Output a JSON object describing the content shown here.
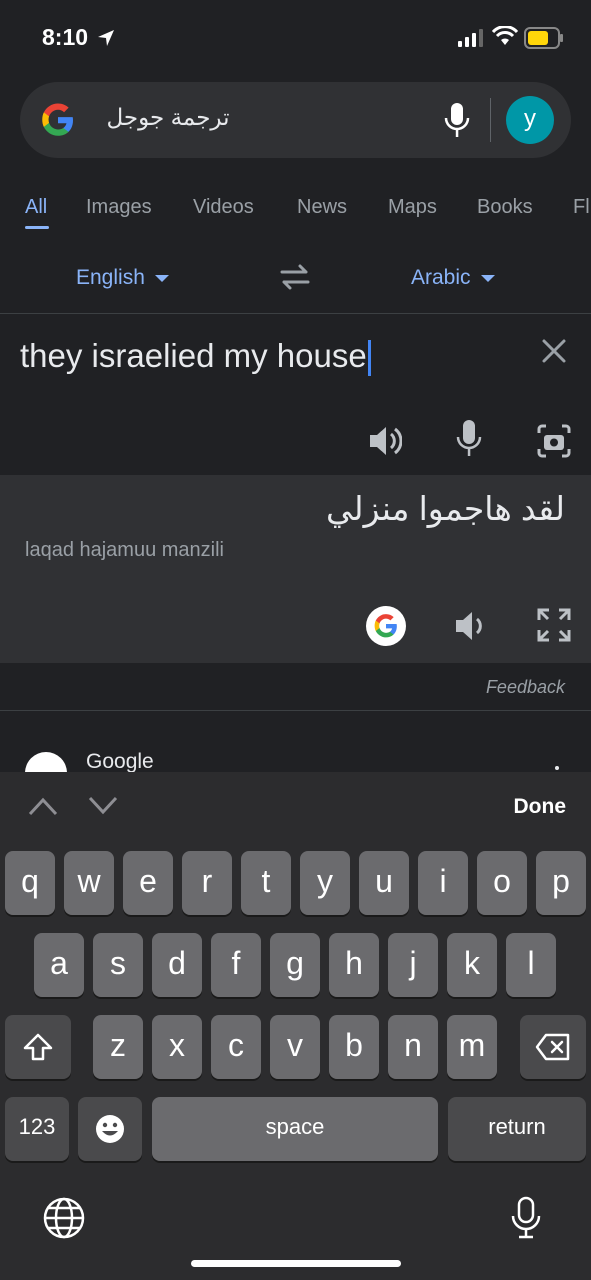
{
  "status": {
    "time": "8:10"
  },
  "search": {
    "query": "ترجمة جوجل",
    "avatar_letter": "y"
  },
  "tabs": [
    {
      "label": "All",
      "active": true
    },
    {
      "label": "Images"
    },
    {
      "label": "Videos"
    },
    {
      "label": "News"
    },
    {
      "label": "Maps"
    },
    {
      "label": "Books"
    },
    {
      "label": "Fl"
    }
  ],
  "translate": {
    "source_lang": "English",
    "target_lang": "Arabic",
    "source_text": "they israelied my house",
    "target_text": "لقد هاجموا منزلي",
    "transliteration": "laqad hajamuu manzili",
    "feedback": "Feedback"
  },
  "result_peek": {
    "title": "Google"
  },
  "keyboard": {
    "done": "Done",
    "row1": [
      "q",
      "w",
      "e",
      "r",
      "t",
      "y",
      "u",
      "i",
      "o",
      "p"
    ],
    "row2": [
      "a",
      "s",
      "d",
      "f",
      "g",
      "h",
      "j",
      "k",
      "l"
    ],
    "row3": [
      "z",
      "x",
      "c",
      "v",
      "b",
      "n",
      "m"
    ],
    "numbers_key": "123",
    "space_key": "space",
    "return_key": "return"
  },
  "colors": {
    "accent": "#8ab4f8",
    "background": "#202124",
    "surface": "#303134",
    "avatar": "#0097a7",
    "battery": "#ffd60a"
  }
}
